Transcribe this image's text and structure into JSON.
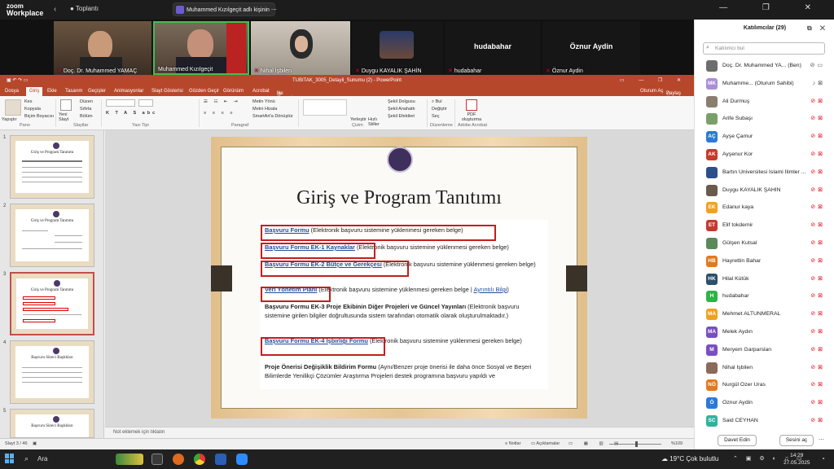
{
  "zoom": {
    "logo_line1": "zoom",
    "logo_line2": "Workplace",
    "meeting_label": "Toplantı",
    "share_label": "Muhammed Kızılgeçit adlı kişinin",
    "window_controls": "— ❐ ✕"
  },
  "videos": [
    {
      "name": "Doç. Dr. Muhammed YAMAÇ"
    },
    {
      "name": "Muhammed Kızılgeçit"
    },
    {
      "name": "Nihal İşbilen"
    },
    {
      "name": "Duygu KAYALIK ŞAHİN"
    },
    {
      "name": "hudabahar",
      "big": "hudabahar"
    },
    {
      "name": "Öznur Aydin",
      "big": "Öznur Aydin"
    }
  ],
  "ppt": {
    "window_title": "TUBITAK_3005_Detayli_Sunumu (2) - PowerPoint",
    "user": "Oturum Aç",
    "share": "Paylaş",
    "tell_me": "Ne yapmak istediğinizi söyleyin...",
    "tabs": [
      "Dosya",
      "Giriş",
      "Ekle",
      "Tasarım",
      "Geçişler",
      "Animasyonlar",
      "Slayt Gösterisi",
      "Gözden Geçir",
      "Görünüm",
      "Acrobat"
    ],
    "ribbon": {
      "paste": "Yapıştır",
      "cut": "Kes",
      "copy": "Kopyala",
      "format_painter": "Biçim Boyacısı",
      "new_slide": "Yeni Slayt",
      "layout": "Düzen",
      "reset": "Sıfırla",
      "section": "Bölüm",
      "text_direction": "Metin Yönü",
      "align_text": "Metni Hizala",
      "smartart": "SmartArt'a Dönüştür",
      "arrange": "Yerleştir",
      "quick_styles": "Hızlı Stiller",
      "shape_fill": "Şekil Dolgusu",
      "shape_outline": "Şekil Anahattı",
      "shape_effects": "Şekil Efektleri",
      "find": "Bul",
      "replace": "Değiştir",
      "select": "Seç",
      "pdf": "PDF oluşturma",
      "g_clipboard": "Pano",
      "g_slides": "Slaytlar",
      "g_font": "Yazı Tipi",
      "g_paragraph": "Paragraf",
      "g_drawing": "Çizim",
      "g_editing": "Düzenleme",
      "g_acrobat": "Adobe Acrobat"
    },
    "thumbnails": [
      {
        "num": "1",
        "title": "Giriş ve Program Tanıtımı"
      },
      {
        "num": "2",
        "title": "Giriş ve Program Tanıtımı"
      },
      {
        "num": "3",
        "title": "Giriş ve Program Tanıtımı"
      },
      {
        "num": "4",
        "title": "Başvuru Süreci Başlıkları"
      },
      {
        "num": "5",
        "title": "Başvuru Süreci Başlıkları"
      }
    ],
    "slide": {
      "title": "Giriş ve Program Tanıtımı",
      "items": [
        {
          "link": "Başvuru Formu",
          "rest": " (Elektronik başvuru sistemine yüklenmesi gereken belge)"
        },
        {
          "link": "Başvuru Formu EK-1 Kaynaklar",
          "rest": " (Elektronik başvuru sistemine yüklenmesi gereken belge)"
        },
        {
          "link": "Başvuru Formu EK-2 Bütçe ve Gerekçesi",
          "rest": " (Elektronik başvuru sistemine yüklenmesi gereken belge)"
        },
        {
          "link": "Veri Yönetim Planı",
          "rest": " (Elektronik başvuru sistemine yüklenmesi gereken belge | ",
          "link2": "Ayrıntılı Bilgi",
          "rest2": ")"
        },
        {
          "bold": "Başvuru Formu EK-3 Proje Ekibinin Diğer Projeleri ve Güncel Yayınları",
          "rest": " (Elektronik başvuru sistemine girilen bilgiler doğrultusunda sistem tarafından otomatik olarak oluşturulmaktadır.)"
        },
        {
          "link": "Başvuru Formu EK-4 İşbirliği Formu",
          "rest": " (Elektronik başvuru sistemine yüklenmesi gereken belge)"
        },
        {
          "bold": "Proje Önerisi Değişiklik Bildirim Formu",
          "rest": " (Aynı/Benzer proje önerisi ile daha önce Sosyal ve Beşeri Bilimlerde Yenilikçi Çözümler Araştırma Projeleri destek programına başvuru yapıldı ve"
        }
      ]
    },
    "notes_placeholder": "Not eklemek için tıklatın",
    "status": {
      "slide": "Slayt 3 / 46",
      "notes": "Notlar",
      "comments": "Açıklamalar",
      "zoom": "%109"
    }
  },
  "participants": {
    "title": "Katılımcılar (29)",
    "search_placeholder": "Katılımcı bul",
    "list": [
      {
        "initials": "",
        "name": "Doç. Dr. Muhammed YA...",
        "tag": "(Ben)",
        "color": "#6d6d6d"
      },
      {
        "initials": "MK",
        "name": "Muhamme...",
        "tag": "(Oturum Sahibi)",
        "color": "#a98fd6"
      },
      {
        "initials": "",
        "name": "Ali Durmuş",
        "tag": "",
        "color": "#8a7f6e"
      },
      {
        "initials": "",
        "name": "Arife Subaşı",
        "tag": "",
        "color": "#7aa06a"
      },
      {
        "initials": "AÇ",
        "name": "Ayşe Çamur",
        "tag": "",
        "color": "#2a7ad6"
      },
      {
        "initials": "AK",
        "name": "Ayşenur Kor",
        "tag": "",
        "color": "#c6392e"
      },
      {
        "initials": "",
        "name": "Bartın Üniversitesi İslami İlimler ...",
        "tag": "",
        "color": "#2c4f8a"
      },
      {
        "initials": "",
        "name": "Duygu KAYALIK ŞAHİN",
        "tag": "",
        "color": "#6a5a4e"
      },
      {
        "initials": "EK",
        "name": "Edanur kaya",
        "tag": "",
        "color": "#f0a21e"
      },
      {
        "initials": "ET",
        "name": "Elif tokdemir",
        "tag": "",
        "color": "#c6392e"
      },
      {
        "initials": "",
        "name": "Gülşen Kutsal",
        "tag": "",
        "color": "#5a8a5a"
      },
      {
        "initials": "HB",
        "name": "Hayrettin Bahar",
        "tag": "",
        "color": "#e07a20"
      },
      {
        "initials": "HK",
        "name": "Hilal Kütük",
        "tag": "",
        "color": "#2c4f6a"
      },
      {
        "initials": "H",
        "name": "hudabahar",
        "tag": "",
        "color": "#2fb34a"
      },
      {
        "initials": "MA",
        "name": "Mehmet ALTUNMERAL",
        "tag": "",
        "color": "#f0a21e"
      },
      {
        "initials": "MA",
        "name": "Melek Aydın",
        "tag": "",
        "color": "#7a4fc0"
      },
      {
        "initials": "M",
        "name": "Meryem Garparslan",
        "tag": "",
        "color": "#7a4fc0"
      },
      {
        "initials": "",
        "name": "Nihal İşbilen",
        "tag": "",
        "color": "#8a6a5a"
      },
      {
        "initials": "NÖ",
        "name": "Nurgül Özer Uras",
        "tag": "",
        "color": "#e07a20"
      },
      {
        "initials": "Ö",
        "name": "Öznur Aydin",
        "tag": "",
        "color": "#2a7ad6"
      },
      {
        "initials": "SC",
        "name": "Said CEYHAN",
        "tag": "",
        "color": "#2fb3a0"
      }
    ],
    "invite": "Davet Edin",
    "mute_all": "Sesini aç"
  },
  "taskbar": {
    "search": "Ara",
    "weather": "19°C  Çok bulutlu",
    "time": "14:29",
    "date": "27.05.2025"
  }
}
